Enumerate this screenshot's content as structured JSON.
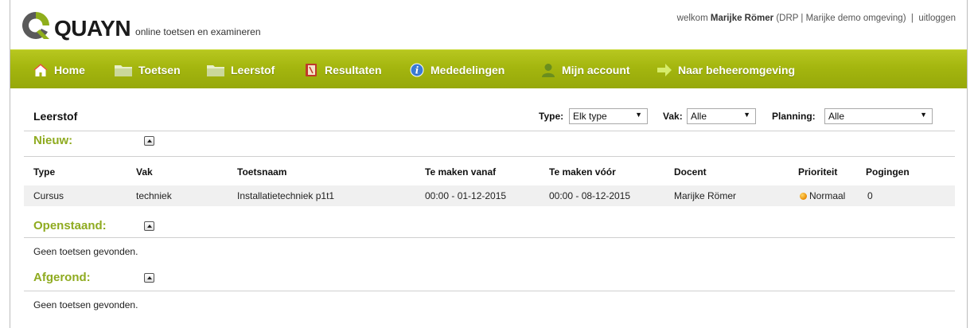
{
  "header": {
    "brand": "QUAYN",
    "tagline": "online toetsen en examineren",
    "welcome_prefix": "welkom",
    "user_name": "Marijke Römer",
    "user_context": "(DRP | Marijke demo omgeving)",
    "separator": "|",
    "logout": "uitloggen"
  },
  "nav": {
    "home": "Home",
    "toetsen": "Toetsen",
    "leerstof": "Leerstof",
    "resultaten": "Resultaten",
    "mededelingen": "Mededelingen",
    "account": "Mijn account",
    "beheer": "Naar beheeromgeving"
  },
  "page": {
    "title": "Leerstof",
    "filters": {
      "type_label": "Type:",
      "type_value": "Elk type",
      "vak_label": "Vak:",
      "vak_value": "Alle",
      "planning_label": "Planning:",
      "planning_value": "Alle"
    }
  },
  "sections": {
    "nieuw": {
      "title": "Nieuw:",
      "columns": [
        "Type",
        "Vak",
        "Toetsnaam",
        "Te maken vanaf",
        "Te maken vóór",
        "Docent",
        "Prioriteit",
        "Pogingen"
      ],
      "rows": [
        {
          "type": "Cursus",
          "vak": "techniek",
          "toetsnaam": "Installatietechniek p1t1",
          "vanaf": "00:00 - 01-12-2015",
          "voor": "00:00 - 08-12-2015",
          "docent": "Marijke Römer",
          "prioriteit": "Normaal",
          "pogingen": "0"
        }
      ]
    },
    "openstaand": {
      "title": "Openstaand:",
      "empty": "Geen toetsen gevonden."
    },
    "afgerond": {
      "title": "Afgerond:",
      "empty": "Geen toetsen gevonden."
    }
  },
  "colors": {
    "nav_green": "#a4b60f",
    "section_title_green": "#8fab20",
    "priority_normal": "#f0a010"
  },
  "icons": {
    "home": "home-icon",
    "toetsen": "folder-icon",
    "leerstof": "folder-icon",
    "resultaten": "notebook-icon",
    "mededelingen": "info-icon",
    "account": "user-icon",
    "beheer": "arrow-right-icon",
    "toggle": "collapse-icon"
  }
}
